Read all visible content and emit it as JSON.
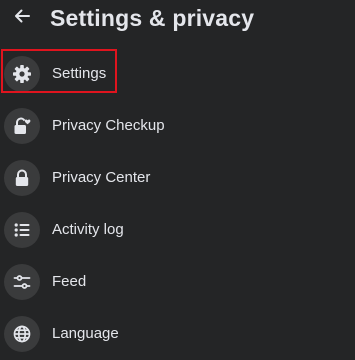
{
  "header": {
    "title": "Settings & privacy",
    "back_icon": "arrow-left-icon"
  },
  "menu": {
    "items": [
      {
        "label": "Settings",
        "icon": "gear-icon",
        "highlighted": true
      },
      {
        "label": "Privacy Checkup",
        "icon": "lock-heart-icon"
      },
      {
        "label": "Privacy Center",
        "icon": "lock-icon"
      },
      {
        "label": "Activity log",
        "icon": "list-icon"
      },
      {
        "label": "Feed",
        "icon": "sliders-icon"
      },
      {
        "label": "Language",
        "icon": "globe-icon"
      }
    ]
  },
  "colors": {
    "background": "#242526",
    "icon_circle": "#3a3b3c",
    "text": "#e4e6eb",
    "highlight": "#e0141e"
  }
}
